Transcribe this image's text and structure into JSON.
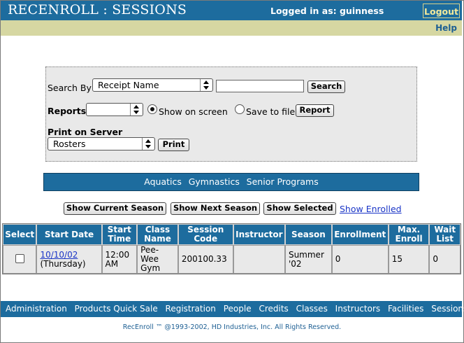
{
  "header": {
    "app_title": "RECENROLL : SESSIONS",
    "logged_in_text": "Logged in as: guinness",
    "logout_label": "Logout",
    "help_label": "Help"
  },
  "search": {
    "search_by_label": "Search By",
    "search_by_selected": "Receipt Name",
    "search_input_value": "",
    "search_button": "Search",
    "reports_label": "Reports",
    "reports_selected": "",
    "show_on_screen_label": "Show on screen",
    "show_on_screen_checked": true,
    "save_to_file_label": "Save to file",
    "save_to_file_checked": false,
    "report_button": "Report",
    "print_on_server_label": "Print on Server",
    "print_selected": "Rosters",
    "print_button": "Print"
  },
  "categories": [
    "Aquatics",
    "Gymnastics",
    "Senior Programs"
  ],
  "season_buttons": {
    "show_current": "Show Current Season",
    "show_next": "Show Next Season",
    "show_selected": "Show Selected",
    "show_enrolled": "Show Enrolled"
  },
  "table": {
    "headers": [
      "Select",
      "Start Date",
      "Start Time",
      "Class Name",
      "Session Code",
      "Instructor",
      "Season",
      "Enrollment",
      "Max. Enroll",
      "Wait List"
    ],
    "rows": [
      {
        "start_date": "10/10/02",
        "start_day": "(Thursday)",
        "start_time": "12:00 AM",
        "class_name": "Pee-Wee Gym",
        "session_code": "200100.33",
        "instructor": "",
        "season": "Summer '02",
        "enrollment": "0",
        "max_enroll": "15",
        "wait_list": "0"
      }
    ]
  },
  "footer": {
    "nav": [
      "Administration",
      "Products Quick Sale",
      "Registration",
      "People",
      "Credits",
      "Classes",
      "Instructors",
      "Facilities",
      "Sessions"
    ],
    "copyright": "RecEnroll ™ @1993-2002, HD Industries, Inc.  All Rights Reserved."
  },
  "colors": {
    "header_blue": "#1d6c9e",
    "help_bar": "#d6d7a2",
    "panel_gray": "#e9e9e9",
    "logout_text": "#f3ea9b",
    "link_blue": "#1a35c7"
  }
}
